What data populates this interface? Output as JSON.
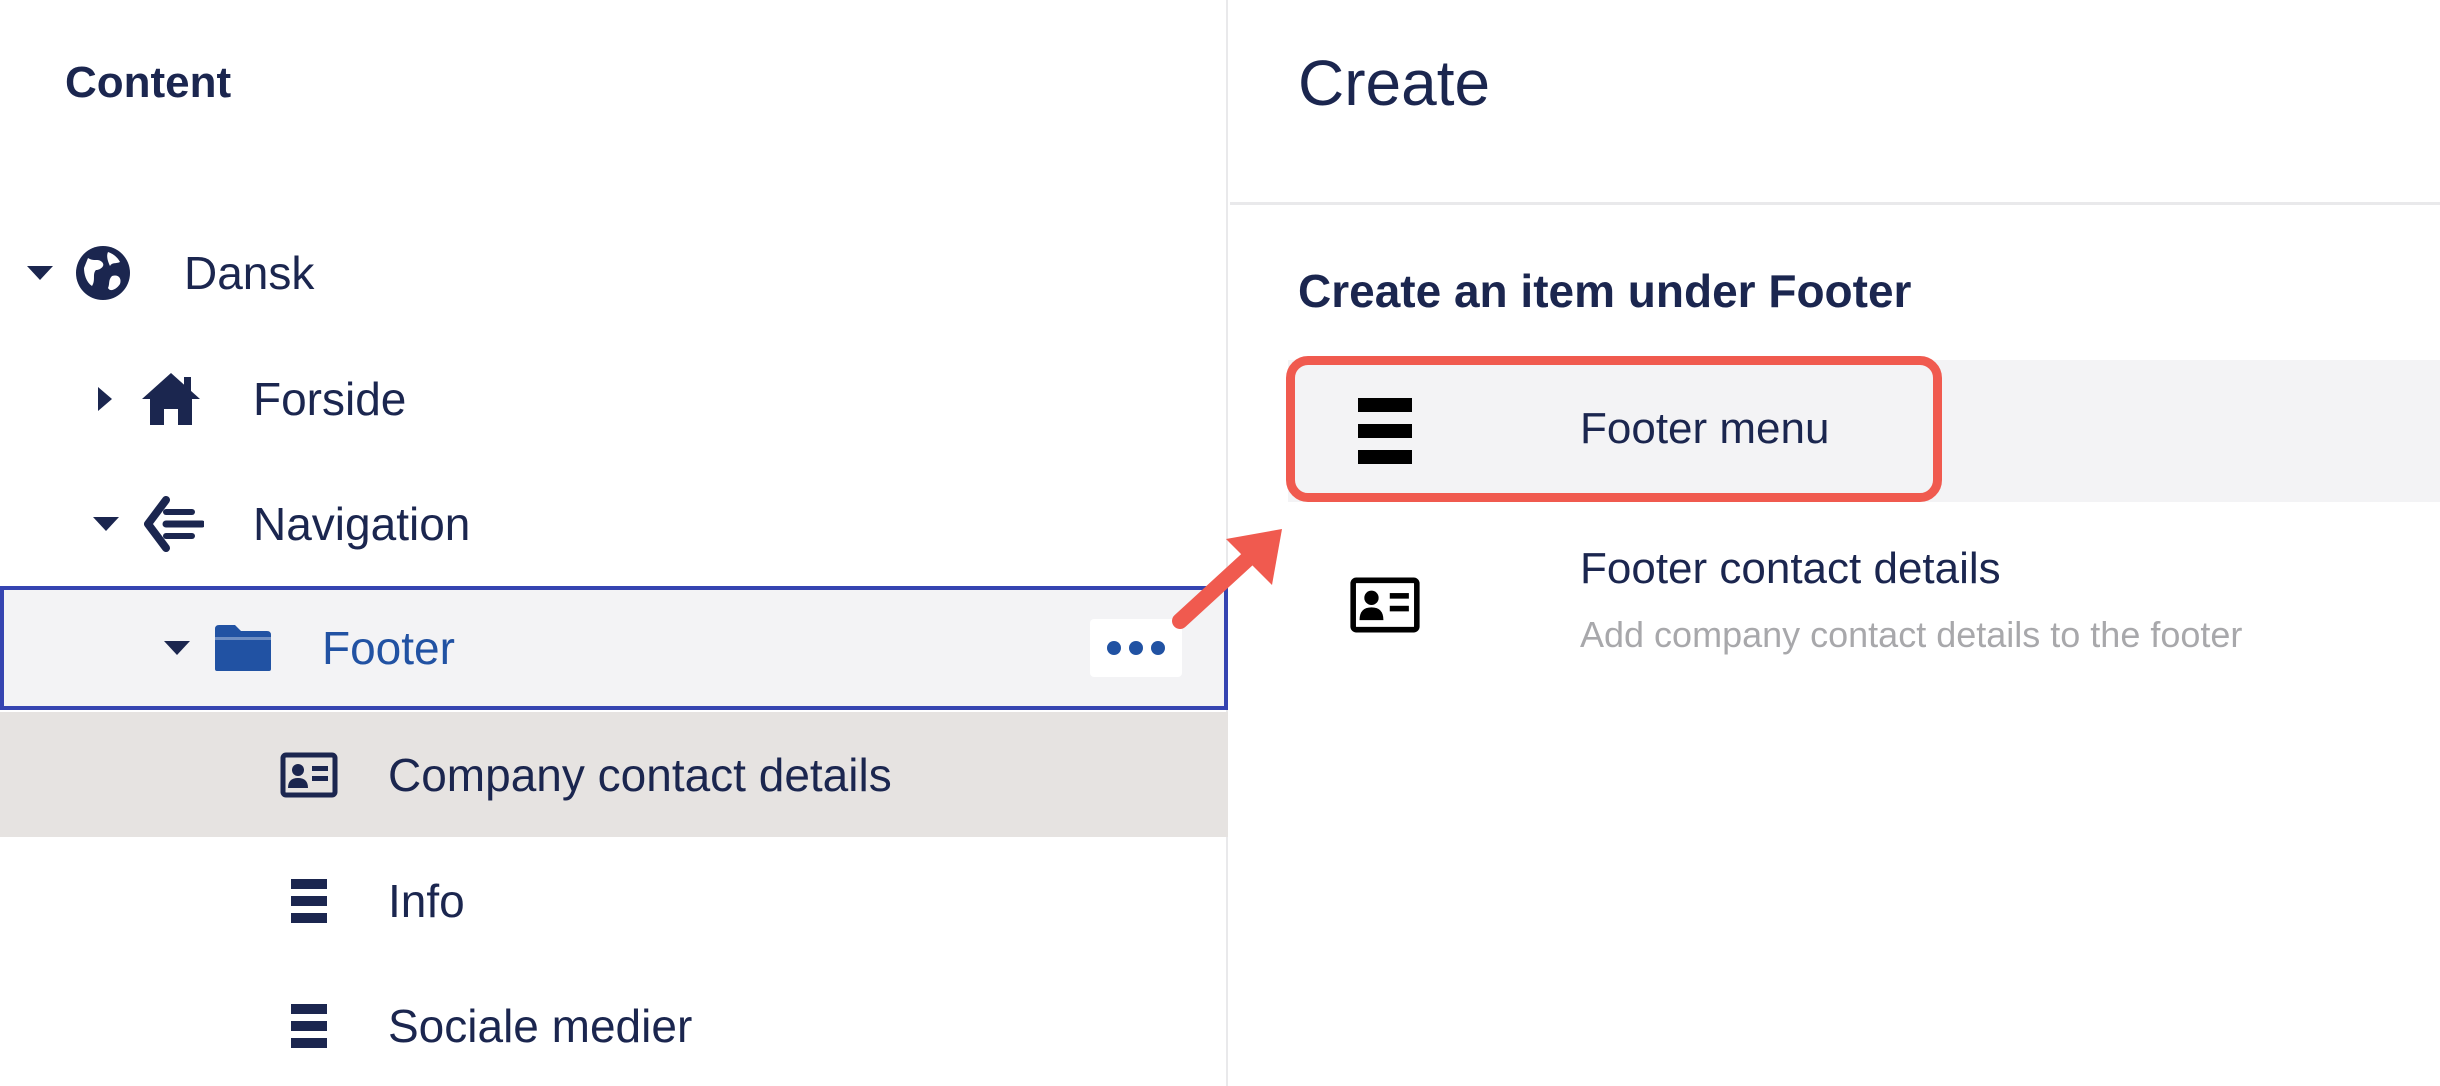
{
  "sidebar": {
    "title": "Content",
    "tree": [
      {
        "label": "Dansk",
        "icon": "globe-icon",
        "caret": "expanded"
      },
      {
        "label": "Forside",
        "icon": "home-icon",
        "caret": "collapsed"
      },
      {
        "label": "Navigation",
        "icon": "navigation-icon",
        "caret": "expanded"
      },
      {
        "label": "Footer",
        "icon": "folder-icon",
        "caret": "expanded",
        "state": "selected",
        "actions_icon": "more-options-icon"
      },
      {
        "label": "Company contact details",
        "icon": "contact-card-icon",
        "state": "hover"
      },
      {
        "label": "Info",
        "icon": "list-icon"
      },
      {
        "label": "Sociale medier",
        "icon": "list-icon"
      }
    ]
  },
  "panel": {
    "title": "Create",
    "section_title": "Create an item under Footer",
    "items": [
      {
        "name": "Footer menu",
        "icon": "list-icon",
        "highlighted": true
      },
      {
        "name": "Footer contact details",
        "description": "Add company contact details to the footer",
        "icon": "contact-card-icon"
      }
    ]
  },
  "colors": {
    "text_primary": "#1b264f",
    "selected_border": "#3544b1",
    "selected_text": "#2152a3",
    "hover_background": "#e6e3e1",
    "annotation": "#f05a4f"
  }
}
